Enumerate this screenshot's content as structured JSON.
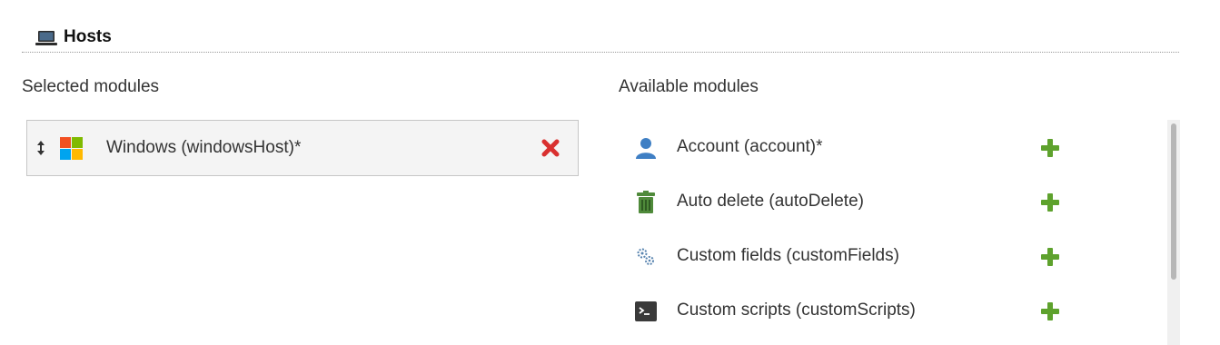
{
  "section": {
    "title": "Hosts",
    "icon": "laptop-icon"
  },
  "selected": {
    "heading": "Selected modules",
    "items": [
      {
        "label": "Windows (windowsHost)*",
        "icon": "windows-logo-icon"
      }
    ]
  },
  "available": {
    "heading": "Available modules",
    "items": [
      {
        "label": "Account (account)*",
        "icon": "user-icon"
      },
      {
        "label": "Auto delete (autoDelete)",
        "icon": "trash-icon"
      },
      {
        "label": "Custom fields (customFields)",
        "icon": "gears-icon"
      },
      {
        "label": "Custom scripts (customScripts)",
        "icon": "terminal-icon"
      }
    ]
  },
  "colors": {
    "add": "#5ea22d",
    "remove": "#d9302f",
    "user": "#3f7fc4",
    "trash": "#4f8a3a"
  }
}
